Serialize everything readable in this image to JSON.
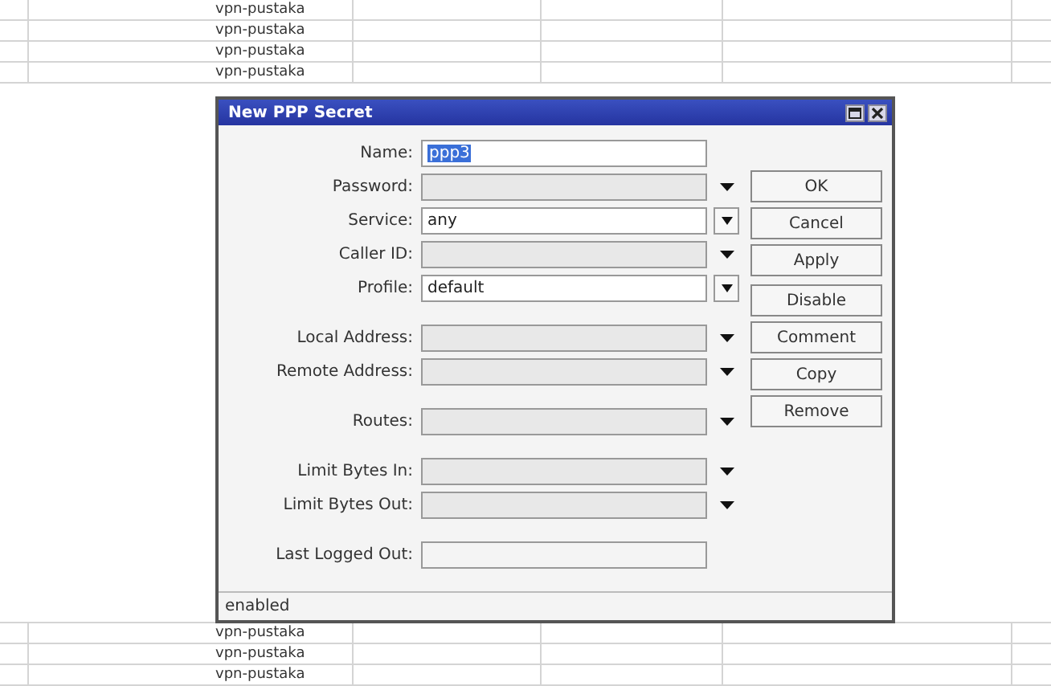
{
  "list_rows_above": [
    "vpn-pustaka",
    "vpn-pustaka",
    "vpn-pustaka",
    "vpn-pustaka"
  ],
  "list_rows_below": [
    "vpn-pustaka",
    "vpn-pustaka",
    "vpn-pustaka"
  ],
  "window": {
    "title": "New PPP Secret"
  },
  "field_groups": [
    [
      {
        "label": "Name:",
        "value": "ppp3",
        "value_selected": true,
        "kind": "text"
      },
      {
        "label": "Password:",
        "kind": "dropdown"
      },
      {
        "label": "Service:",
        "value": "any",
        "kind": "select"
      },
      {
        "label": "Caller ID:",
        "kind": "dropdown"
      },
      {
        "label": "Profile:",
        "value": "default",
        "kind": "select"
      }
    ],
    [
      {
        "label": "Local Address:",
        "kind": "dropdown"
      },
      {
        "label": "Remote Address:",
        "kind": "dropdown"
      }
    ],
    [
      {
        "label": "Routes:",
        "kind": "dropdown"
      }
    ],
    [
      {
        "label": "Limit Bytes In:",
        "kind": "dropdown"
      },
      {
        "label": "Limit Bytes Out:",
        "kind": "dropdown"
      }
    ],
    [
      {
        "label": "Last Logged Out:",
        "kind": "readonly"
      }
    ]
  ],
  "button_groups": [
    [
      "OK",
      "Cancel",
      "Apply"
    ],
    [
      "Disable",
      "Comment",
      "Copy",
      "Remove"
    ]
  ],
  "status_bar": "enabled"
}
